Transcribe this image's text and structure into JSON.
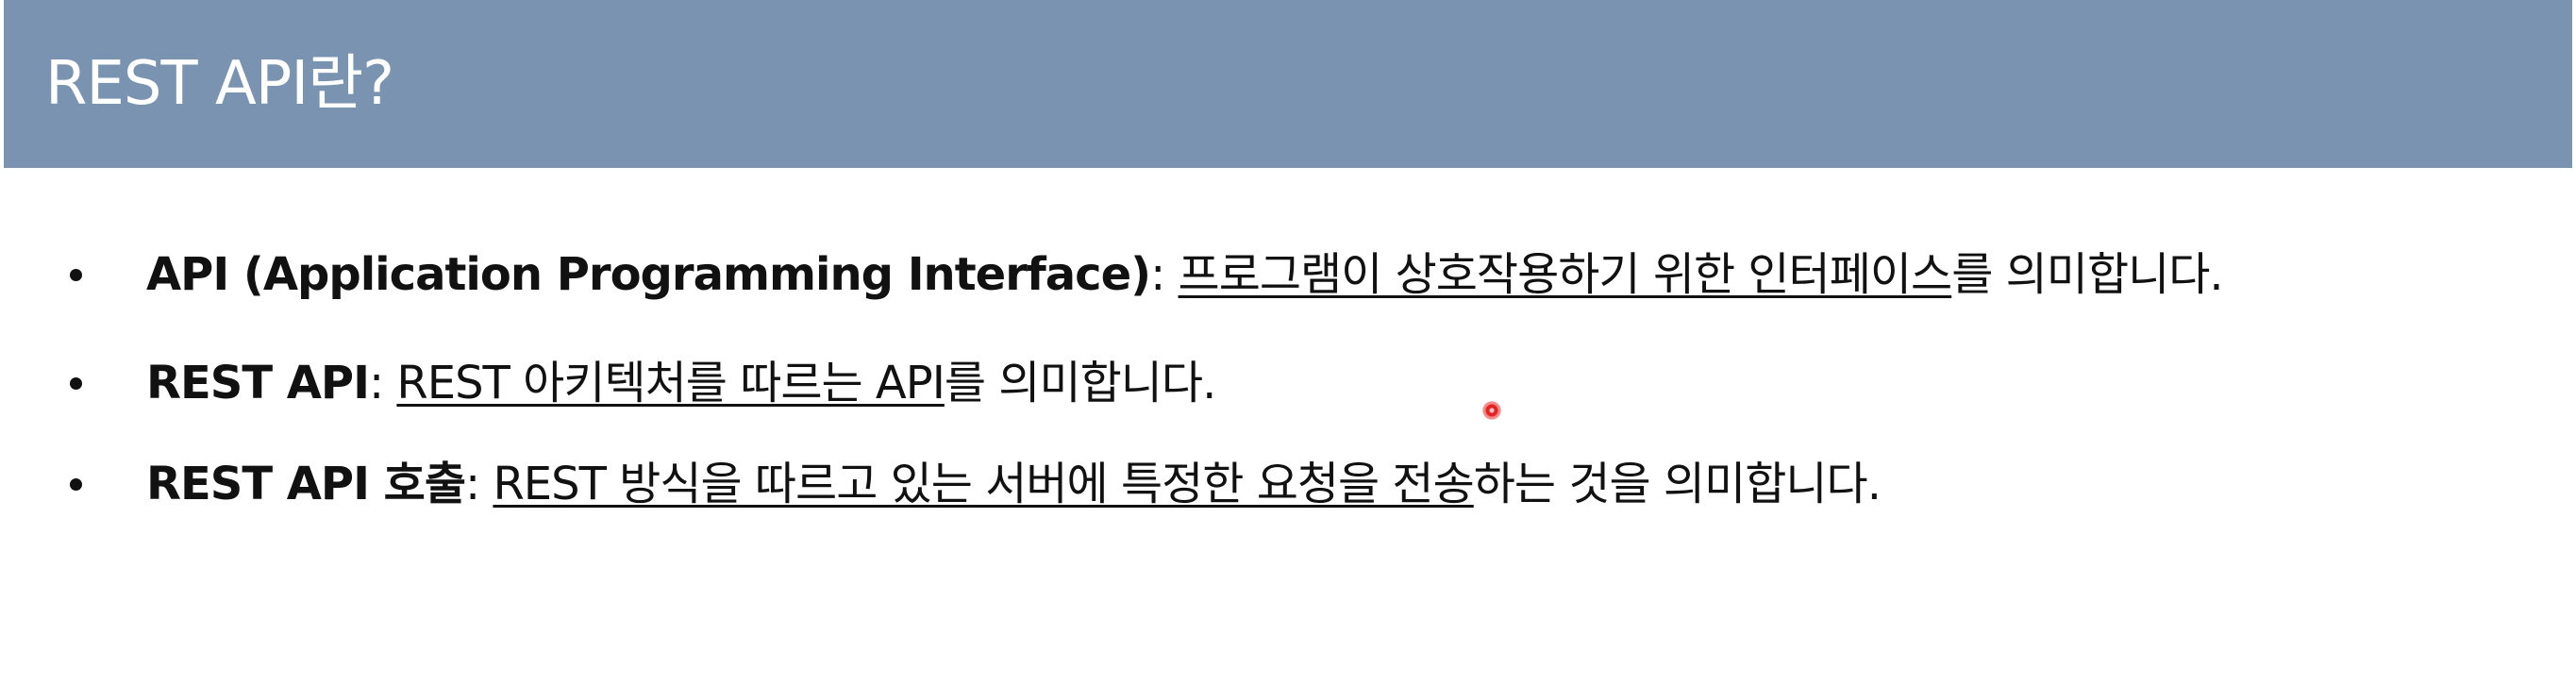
{
  "slide": {
    "title": "REST API란?",
    "bullets": [
      {
        "term": "API (Application Programming Interface)",
        "colon": ": ",
        "underlined": "프로그램이 상호작용하기 위한 인터페이스",
        "rest": "를 의미합니다."
      },
      {
        "term": "REST API",
        "colon": ": ",
        "underlined": "REST 아키텍처를 따르는 API",
        "rest": "를 의미합니다."
      },
      {
        "term": "REST API 호출",
        "colon": ": ",
        "underlined": "REST 방식을 따르고 있는 서버에 특정한 요청을 전송",
        "rest": "하는 것을 의미합니다."
      }
    ]
  },
  "colors": {
    "title_bar": "#7993b0",
    "title_text": "#ffffff",
    "body_text": "#111111",
    "pointer": "#e52222"
  },
  "icons": {
    "pointer": "laser-pointer-icon"
  }
}
